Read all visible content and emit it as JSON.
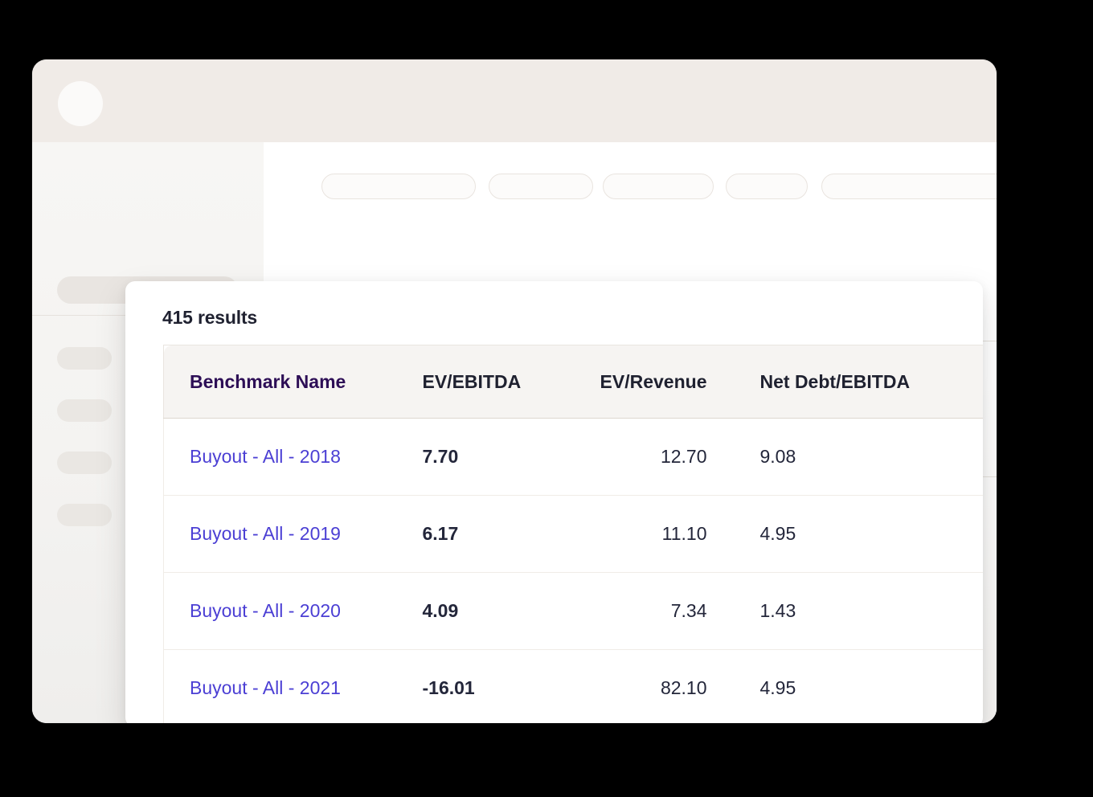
{
  "browser": {
    "chrome": {
      "avatar": "user-avatar",
      "menu_icon": "hamburger-menu-icon",
      "search_placeholder": "",
      "right_icon_1": "circle-placeholder-icon",
      "right_icon_2": "circle-placeholder-icon"
    },
    "sidebar": {
      "header_placeholder": "",
      "items": [
        "",
        "",
        "",
        ""
      ]
    },
    "content": {
      "filter_pills": [
        "",
        "",
        "",
        "",
        ""
      ],
      "bottom_bars": [
        "",
        "",
        "",
        ""
      ]
    }
  },
  "results_card": {
    "count_label": "415 results",
    "table": {
      "columns": [
        {
          "key": "name",
          "label": "Benchmark Name",
          "align": "left"
        },
        {
          "key": "ebitda",
          "label": "EV/EBITDA",
          "align": "left"
        },
        {
          "key": "rev",
          "label": "EV/Revenue",
          "align": "right"
        },
        {
          "key": "debt",
          "label": "Net Debt/EBITDA",
          "align": "left"
        }
      ],
      "rows": [
        {
          "name": "Buyout - All - 2018",
          "ebitda": "7.70",
          "rev": "12.70",
          "debt": "9.08"
        },
        {
          "name": "Buyout - All - 2019",
          "ebitda": "6.17",
          "rev": "11.10",
          "debt": "4.95"
        },
        {
          "name": "Buyout - All - 2020",
          "ebitda": "4.09",
          "rev": "7.34",
          "debt": "1.43"
        },
        {
          "name": "Buyout - All - 2021",
          "ebitda": "-16.01",
          "rev": "82.10",
          "debt": "4.95"
        }
      ]
    }
  },
  "colors": {
    "backdrop": "#000000",
    "chrome_bg": "#f0ebe7",
    "sidebar_bg": "#f5f4f2",
    "card_bg": "#ffffff",
    "link": "#4b3fd4",
    "header_accent": "#2d0e56",
    "text": "#23263a",
    "table_header_bg": "#f6f4f2"
  }
}
